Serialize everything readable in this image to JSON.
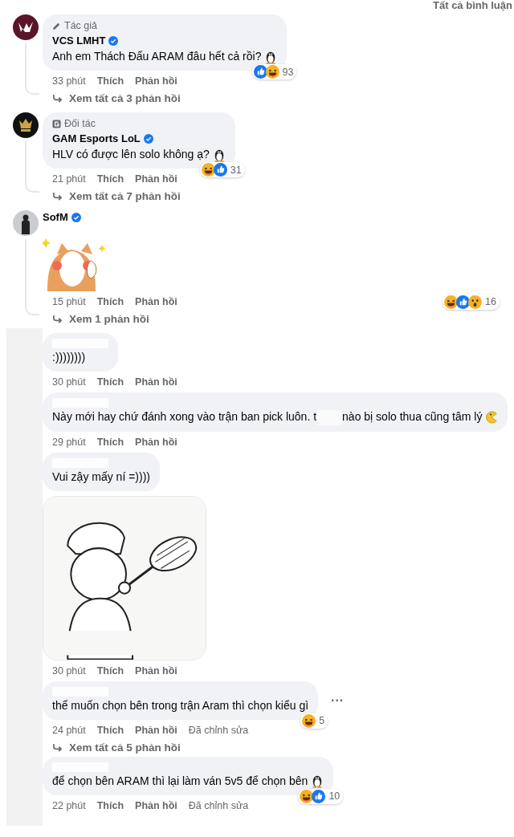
{
  "header": {
    "sort_label": "Tất cả bình luận"
  },
  "comments": [
    {
      "kind": "text",
      "avatar": {
        "kind": "vcs"
      },
      "badge": {
        "kind": "author",
        "label": "Tác giả"
      },
      "name": "VCS LMHT",
      "verified": true,
      "segments": [
        {
          "kind": "text",
          "text": "Anh em Thách Đấu ARAM đâu hết cả rồi?"
        }
      ],
      "trailing_icon": {
        "kind": "penguin"
      },
      "reactions": {
        "types": [
          {
            "kind": "like"
          },
          {
            "kind": "haha"
          }
        ],
        "count": "93"
      },
      "time": "33 phút",
      "like": "Thích",
      "reply": "Phản hồi",
      "view_replies": "Xem tất cả 3 phản hồi"
    },
    {
      "kind": "text",
      "avatar": {
        "kind": "gam"
      },
      "badge": {
        "kind": "partner",
        "label": "Đối tác"
      },
      "name": "GAM Esports LoL",
      "verified": true,
      "segments": [
        {
          "kind": "text",
          "text": "HLV có được lên solo không ạ?"
        }
      ],
      "trailing_icon": {
        "kind": "penguin"
      },
      "reactions": {
        "types": [
          {
            "kind": "haha"
          },
          {
            "kind": "like"
          }
        ],
        "count": "31"
      },
      "time": "21 phút",
      "like": "Thích",
      "reply": "Phản hồi",
      "view_replies": "Xem tất cả 7 phản hồi"
    },
    {
      "kind": "sticker",
      "avatar": {
        "kind": "person"
      },
      "name": "SofM",
      "verified": true,
      "reactions": {
        "types": [
          {
            "kind": "haha"
          },
          {
            "kind": "like"
          },
          {
            "kind": "wow"
          }
        ],
        "count": "16"
      },
      "time": "15 phút",
      "like": "Thích",
      "reply": "Phản hồi",
      "view_replies": "Xem 1 phản hồi"
    }
  ],
  "replies": [
    {
      "kind": "text",
      "name_hidden": true,
      "segments": [
        {
          "kind": "text",
          "text": ":))))))))"
        }
      ],
      "time": "30 phút",
      "like": "Thích",
      "reply": "Phản hồi"
    },
    {
      "kind": "text",
      "name_hidden": true,
      "segments": [
        {
          "kind": "text",
          "text": "Này mới hay chứ đánh xong vào trận ban pick luôn. t"
        },
        {
          "kind": "hidden"
        },
        {
          "kind": "text",
          "text": "nào bị solo thua cũng tâm lý"
        }
      ],
      "trailing_icon": {
        "kind": "pacman"
      },
      "time": "29 phút",
      "like": "Thích",
      "reply": "Phản hồi"
    },
    {
      "name_hidden": true,
      "segments": [
        {
          "kind": "text",
          "text": "Vui zậy mấy ní =))))"
        }
      ],
      "time": "30 phút",
      "like": "Thích",
      "reply": "Phản hồi"
    },
    {
      "kind": "text",
      "name_hidden": true,
      "segments": [
        {
          "kind": "text",
          "text": "thế muốn chọn bên trong trận Aram thì chọn kiểu gì"
        }
      ],
      "more": "···",
      "reactions": {
        "types": [
          {
            "kind": "haha"
          }
        ],
        "count": "5"
      },
      "time": "24 phút",
      "like": "Thích",
      "reply": "Phản hồi",
      "edited": "Đã chỉnh sửa",
      "view_replies": "Xem tất cả 5 phản hồi"
    },
    {
      "kind": "text",
      "name_hidden": true,
      "segments": [
        {
          "kind": "text",
          "text": "để chọn bên ARAM thì lại làm ván 5v5 để chọn bên"
        }
      ],
      "trailing_icon": {
        "kind": "penguin"
      },
      "reactions": {
        "types": [
          {
            "kind": "haha"
          },
          {
            "kind": "like"
          }
        ],
        "count": "10"
      },
      "time": "22 phút",
      "like": "Thích",
      "reply": "Phản hồi",
      "edited": "Đã chỉnh sửa"
    }
  ]
}
